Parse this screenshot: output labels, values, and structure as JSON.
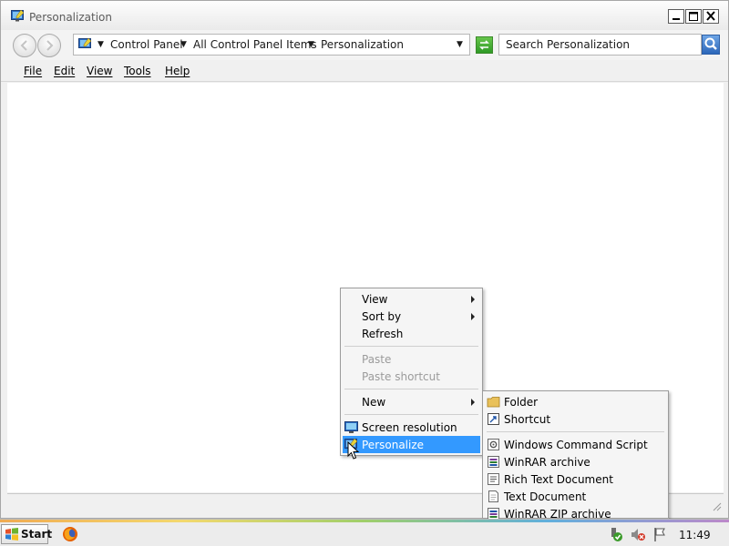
{
  "window": {
    "title": "Personalization"
  },
  "address": {
    "crumbs": [
      "Control Panel",
      "All Control Panel Items",
      "Personalization"
    ]
  },
  "search": {
    "placeholder": "Search Personalization"
  },
  "menubar": {
    "items": [
      "File",
      "Edit",
      "View",
      "Tools",
      "Help"
    ]
  },
  "context_menu": {
    "items": [
      {
        "label": "View",
        "enabled": true,
        "submenu": true
      },
      {
        "label": "Sort by",
        "enabled": true,
        "submenu": true
      },
      {
        "label": "Refresh",
        "enabled": true,
        "submenu": false
      },
      {
        "label": "Paste",
        "enabled": false,
        "submenu": false
      },
      {
        "label": "Paste shortcut",
        "enabled": false,
        "submenu": false
      },
      {
        "label": "New",
        "enabled": true,
        "submenu": true
      },
      {
        "label": "Screen resolution",
        "enabled": true,
        "icon": "display-icon"
      },
      {
        "label": "Personalize",
        "enabled": true,
        "highlighted": true,
        "icon": "personalize-icon"
      }
    ]
  },
  "new_submenu": {
    "items": [
      {
        "label": "Folder",
        "icon": "folder-icon"
      },
      {
        "label": "Shortcut",
        "icon": "shortcut-icon"
      },
      {
        "label": "Windows Command Script",
        "icon": "script-icon"
      },
      {
        "label": "WinRAR archive",
        "icon": "archive-icon"
      },
      {
        "label": "Rich Text Document",
        "icon": "rtf-icon"
      },
      {
        "label": "Text Document",
        "icon": "text-file-icon"
      },
      {
        "label": "WinRAR ZIP archive",
        "icon": "zip-icon"
      }
    ]
  },
  "taskbar": {
    "start_label": "Start",
    "clock": "11:49"
  },
  "colors": {
    "highlight": "#3399ff",
    "disabled_text": "#9b9b9b"
  }
}
